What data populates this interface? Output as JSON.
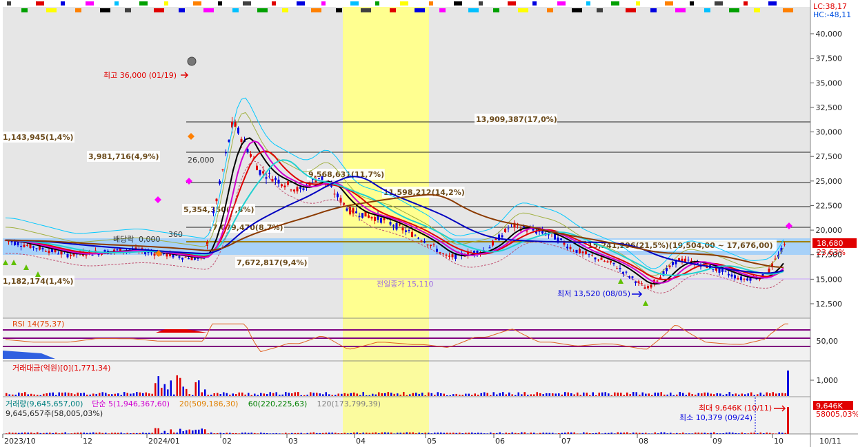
{
  "chart_data": {
    "type": "candlestick",
    "x_labels": [
      "2023/10",
      "12",
      "2024/01",
      "02",
      "03",
      "04",
      "05",
      "06",
      "07",
      "08",
      "09",
      "10",
      "10/11"
    ],
    "price_axis": {
      "ticks": [
        "40,000",
        "37,500",
        "35,000",
        "32,500",
        "30,000",
        "27,500",
        "25,000",
        "22,500",
        "20,000",
        "17,500",
        "15,000",
        "12,500"
      ],
      "tick_values": [
        40000,
        37500,
        35000,
        32500,
        30000,
        27500,
        25000,
        22500,
        20000,
        17500,
        15000,
        12500
      ],
      "ylim": [
        11000,
        42000
      ]
    },
    "corner_labels": {
      "lc": "LC:38,17",
      "hc": "HC:-48,11"
    },
    "current_price": "18,680",
    "current_change": "23,63%",
    "annotations": {
      "high": "최고 36,000 (01/19)",
      "low": "최저 13,520 (08/05)",
      "prev_close": "전일종가 15,110",
      "dividend": "배당락",
      "misc_price": "26,000",
      "dividend_value": "0,000",
      "dividend_value2": "360"
    },
    "volume_profile": [
      {
        "label": "13,909,387(17,0%)",
        "level": 31000
      },
      {
        "label": "1,143,945(1,4%)",
        "level": 29500
      },
      {
        "label": "3,981,716(4,9%)",
        "level": 27500
      },
      {
        "label": "9,568,631(11,7%)",
        "level": 25600
      },
      {
        "label": "11,598,212(14,2%)",
        "level": 24000
      },
      {
        "label": "5,354,350(7,8%)",
        "level": 22000
      },
      {
        "label": "7,079,470(8,7%)",
        "level": 20000
      },
      {
        "label": "15,241,296(21,5%)(19,504,00 ~ 17,676,00)",
        "level": 18600
      },
      {
        "label": "7,672,817(9,4%)",
        "level": 17000
      },
      {
        "label": "1,182,174(1,4%)",
        "level": 15000
      }
    ],
    "price_series_approx": {
      "x": [
        "2023-10-01",
        "2023-11-01",
        "2023-12-01",
        "2024-01-05",
        "2024-01-19",
        "2024-02-01",
        "2024-02-20",
        "2024-03-01",
        "2024-03-15",
        "2024-04-01",
        "2024-04-20",
        "2024-05-01",
        "2024-05-20",
        "2024-06-01",
        "2024-06-20",
        "2024-07-01",
        "2024-07-20",
        "2024-08-05",
        "2024-08-20",
        "2024-09-01",
        "2024-09-20",
        "2024-10-01",
        "2024-10-11"
      ],
      "close": [
        19000,
        17500,
        18000,
        17000,
        31000,
        26000,
        24000,
        25500,
        22000,
        21000,
        19000,
        17200,
        18000,
        20500,
        19500,
        18000,
        16500,
        14000,
        17000,
        16500,
        15000,
        15300,
        18680
      ]
    },
    "rsi": {
      "label": "RSI 14(75,37)",
      "ticks": [
        "50,00"
      ]
    },
    "trading_value": {
      "label": "거래대금(억원)[0](1,771,34)",
      "ticks": [
        "1,000"
      ],
      "current": "1,771,34"
    },
    "volume": {
      "label": "거래량(9,645,657,00)",
      "ma": [
        {
          "name": "단순 5(1,946,367,60)",
          "color": "#d000d0"
        },
        {
          "name": "20(509,186,30)",
          "color": "#e08000"
        },
        {
          "name": "60(220,225,63)",
          "color": "#008000"
        },
        {
          "name": "120(173,799,39)",
          "color": "#808080"
        }
      ],
      "second_line": "9,645,657주(58,005,03%)",
      "max_label": "최대 9,646K (10/11)",
      "min_label": "최소 10,379 (09/24)",
      "current": "9,646K",
      "current_pct": "58005,03%"
    },
    "colors": {
      "up": "#e00000",
      "down": "#0000e0",
      "highlight": "#ffff90",
      "current_box": "#e00000"
    }
  }
}
